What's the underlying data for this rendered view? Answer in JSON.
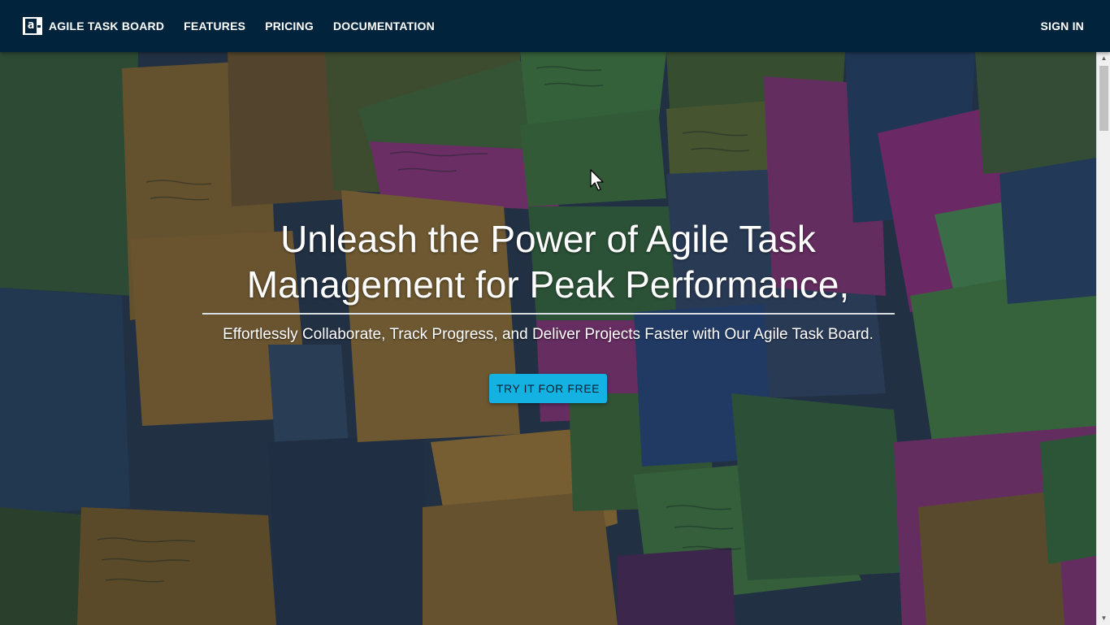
{
  "nav": {
    "brand": "AGILE TASK BOARD",
    "logo_glyph": "a",
    "links": [
      "FEATURES",
      "PRICING",
      "DOCUMENTATION"
    ],
    "sign_in": "SIGN IN"
  },
  "hero": {
    "title_line1": "Unleash the Power of Agile Task",
    "title_line2": "Management for Peak Performance,",
    "subtitle": "Effortlessly Collaborate, Track Progress, and Deliver Projects Faster with Our Agile Task Board.",
    "cta": "TRY IT FOR FREE"
  },
  "colors": {
    "navbar": "#02233c",
    "cta": "#13b2e3",
    "sticky_yellow": "#c9a036",
    "sticky_green": "#4e8a3e",
    "sticky_pink": "#a8307e",
    "sticky_blue": "#2c4f7d"
  },
  "icons": {
    "cursor": "arrow-cursor-icon",
    "logo": "logo-icon"
  }
}
